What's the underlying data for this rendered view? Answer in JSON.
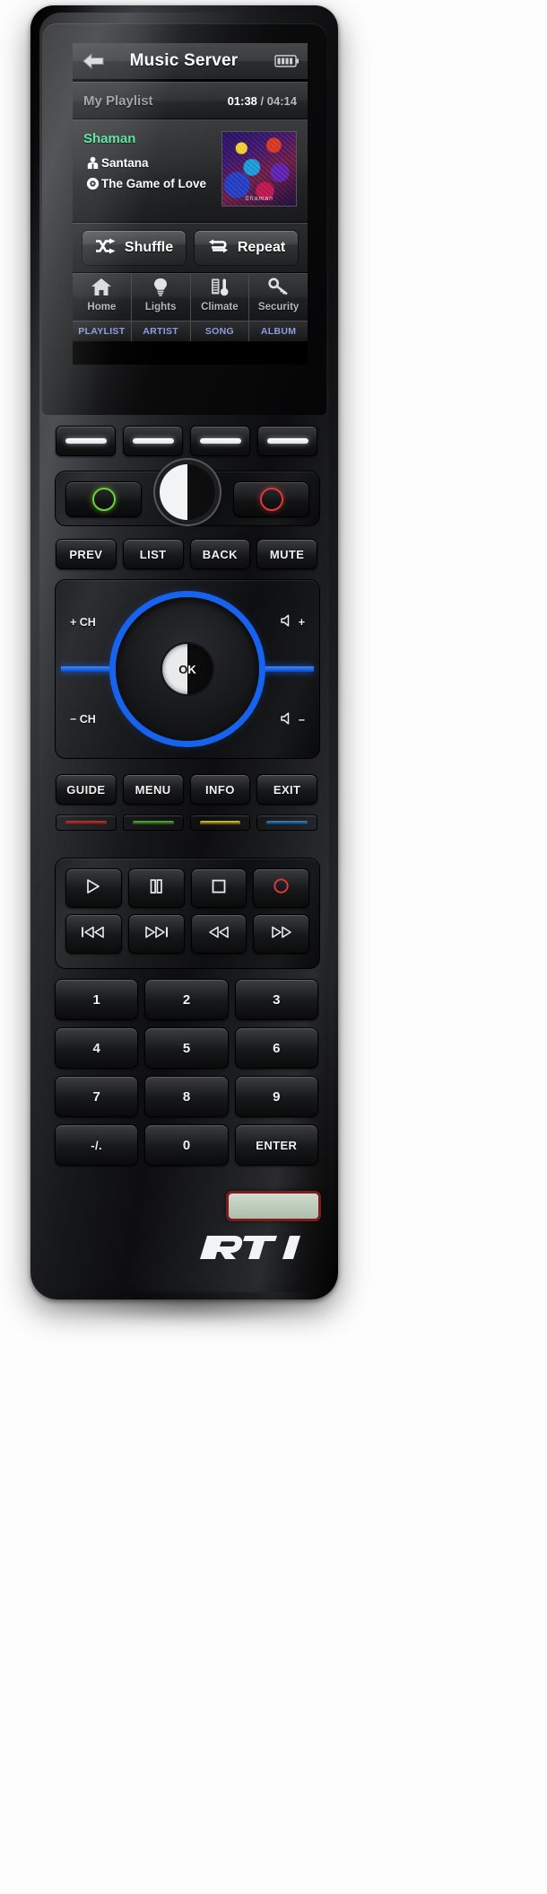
{
  "device": {
    "brand": "RTI",
    "logo_text": "RTI"
  },
  "screen": {
    "titlebar": {
      "title": "Music Server",
      "back_icon": "back-arrow-icon",
      "battery_icon": "battery-icon"
    },
    "playlist_row": {
      "name": "My Playlist",
      "elapsed": "01:38",
      "separator": " / ",
      "total": "04:14"
    },
    "now_playing": {
      "album": "Shaman",
      "artist": "Santana",
      "artist_icon": "person-icon",
      "track": "The Game of Love",
      "track_icon": "disc-icon",
      "art_caption": "Shaman",
      "album_art_alt": "album-art"
    },
    "mode_buttons": [
      {
        "label": "Shuffle",
        "icon": "shuffle-icon"
      },
      {
        "label": "Repeat",
        "icon": "repeat-icon"
      }
    ],
    "tabs": [
      {
        "label": "Home",
        "icon": "home-icon"
      },
      {
        "label": "Lights",
        "icon": "lightbulb-icon"
      },
      {
        "label": "Climate",
        "icon": "thermometer-icon"
      },
      {
        "label": "Security",
        "icon": "key-icon"
      }
    ],
    "sort_bar": [
      "PLAYLIST",
      "ARTIST",
      "SONG",
      "ALBUM"
    ]
  },
  "hardware": {
    "softkeys": [
      "",
      "",
      "",
      ""
    ],
    "power": {
      "on_icon": "power-on-ring-icon",
      "off_icon": "power-off-ring-icon",
      "jog_icon": "jog-wheel"
    },
    "row_prev": [
      "PREV",
      "LIST",
      "BACK",
      "MUTE"
    ],
    "navpad": {
      "ok": "OK",
      "ch_up": "+ CH",
      "ch_down": "− CH",
      "vol_up": "+",
      "vol_down": "−",
      "vol_icon": "speaker-icon"
    },
    "row_guide": [
      "GUIDE",
      "MENU",
      "INFO",
      "EXIT"
    ],
    "color_keys": [
      {
        "name": "red",
        "color": "#d8342f"
      },
      {
        "name": "green",
        "color": "#5dbb3a"
      },
      {
        "name": "yellow",
        "color": "#e8d531"
      },
      {
        "name": "blue",
        "color": "#2f8fd8"
      }
    ],
    "transport_row1": [
      {
        "name": "play",
        "icon": "play-icon"
      },
      {
        "name": "pause",
        "icon": "pause-icon"
      },
      {
        "name": "stop",
        "icon": "stop-icon"
      },
      {
        "name": "record",
        "icon": "record-icon"
      }
    ],
    "transport_row2": [
      {
        "name": "previous-track",
        "icon": "skip-back-icon"
      },
      {
        "name": "next-track",
        "icon": "skip-forward-icon"
      },
      {
        "name": "rewind",
        "icon": "rewind-icon"
      },
      {
        "name": "fast-forward",
        "icon": "fast-forward-icon"
      }
    ],
    "keypad": [
      [
        "1",
        "2",
        "3"
      ],
      [
        "4",
        "5",
        "6"
      ],
      [
        "7",
        "8",
        "9"
      ],
      [
        "-/.",
        "0",
        "ENTER"
      ]
    ]
  },
  "colors": {
    "accent_blue": "#1763f0",
    "album_green": "#4ee49a",
    "sort_blue": "#8b9ce0",
    "power_on_green": "#6fd13a",
    "power_off_red": "#e0383a"
  }
}
